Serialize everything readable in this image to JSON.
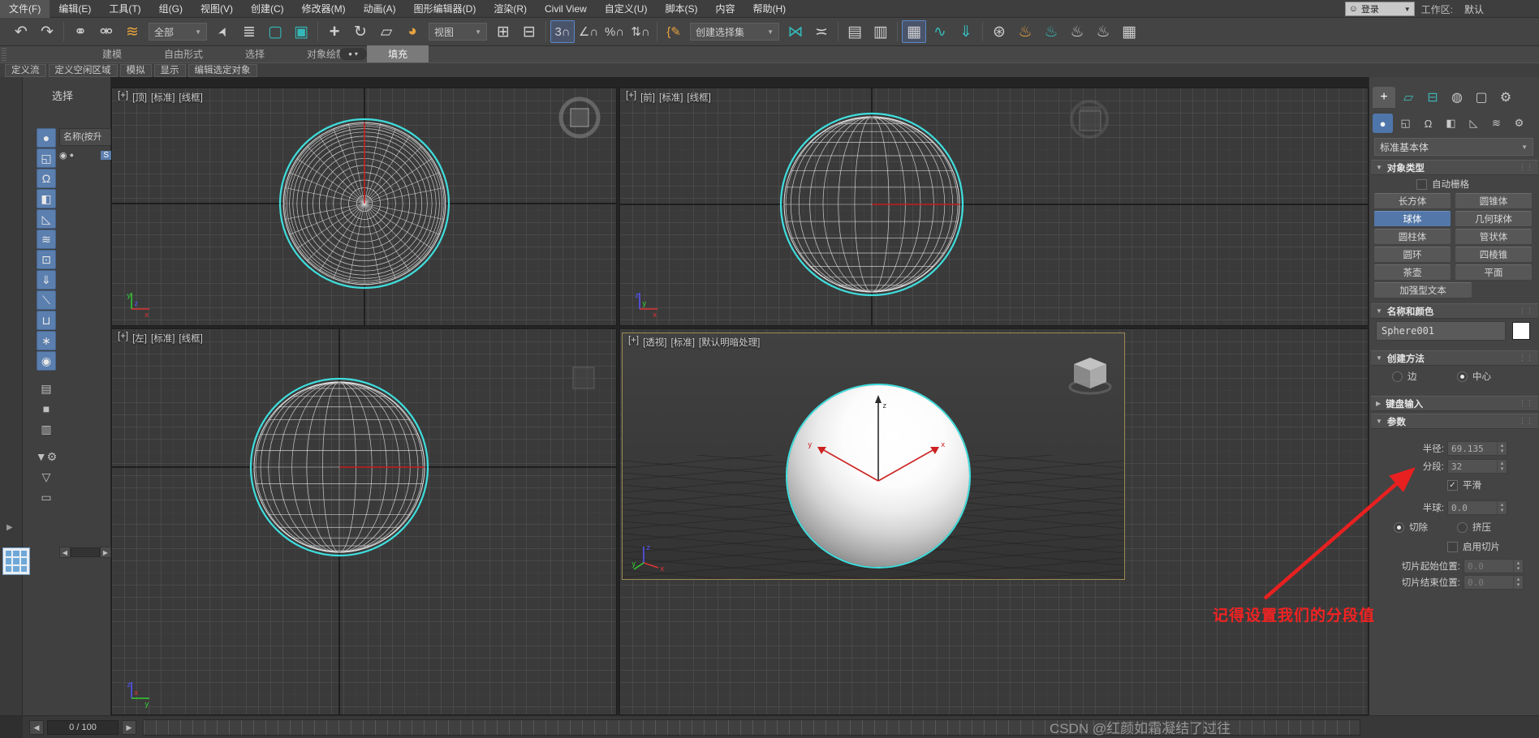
{
  "menubar": {
    "items": [
      "文件(F)",
      "编辑(E)",
      "工具(T)",
      "组(G)",
      "视图(V)",
      "创建(C)",
      "修改器(M)",
      "动画(A)",
      "图形编辑器(D)",
      "渲染(R)",
      "Civil View",
      "自定义(U)",
      "脚本(S)",
      "内容",
      "帮助(H)"
    ],
    "login_icon": "☺",
    "login": "登录",
    "workspace_label": "工作区:",
    "workspace_value": "默认"
  },
  "toolbar": {
    "filter_value": "全部",
    "coord_value": "视图",
    "sets_value": "创建选择集",
    "icons": {
      "undo": "↶",
      "redo": "↷",
      "link": "⚭",
      "unlink": "⚮",
      "bind": "≋",
      "select": "➤",
      "select_by_name": "≣",
      "region": "▢",
      "crossing": "▣",
      "move": "+",
      "rotate": "↻",
      "scale": "▱",
      "placement": "◕",
      "pivot": "⊞",
      "center": "⊟",
      "snap": "3∩",
      "angle_snap": "∠∩",
      "percent_snap": "%∩",
      "spinner_snap": "⇅∩",
      "sets_edit": "{✎",
      "mirror": "⋈",
      "align": "≍",
      "layers": "▤",
      "stack": "▥",
      "ribbon": "▦",
      "curve": "∿",
      "schematic": "⇓",
      "utilities": "⊛",
      "render_setup": "♨",
      "render_frame": "♨",
      "render": "♨",
      "render_cloud": "♨",
      "assets": "▦"
    }
  },
  "ribbon": {
    "tabs": [
      "建模",
      "自由形式",
      "选择",
      "对象绘制",
      "填充"
    ],
    "pill_dot": "●",
    "row2": [
      "定义流",
      "定义空闲区域",
      "模拟",
      "显示",
      "编辑选定对象"
    ]
  },
  "explorer": {
    "title": "选择",
    "header": "名称(按升",
    "row_eye": "◉",
    "row_dot": "●",
    "row_text": "S",
    "scroll_left": "◀",
    "scroll_right": "▶"
  },
  "leftstrip": {
    "expand": "▶"
  },
  "viewports": {
    "top": {
      "labels": [
        "[+]",
        "[顶]",
        "[标准]",
        "[线框]"
      ]
    },
    "front": {
      "labels": [
        "[+]",
        "[前]",
        "[标准]",
        "[线框]"
      ]
    },
    "left": {
      "labels": [
        "[+]",
        "[左]",
        "[标准]",
        "[线框]"
      ]
    },
    "persp": {
      "labels": [
        "[+]",
        "[透视]",
        "[标准]",
        "[默认明暗处理]"
      ]
    },
    "axis": {
      "x": "x",
      "y": "y",
      "z": "z"
    }
  },
  "annotation": {
    "text": "记得设置我们的分段值"
  },
  "panel": {
    "category": "标准基本体",
    "tabs": {
      "create": "+",
      "modify": "▱",
      "hierarchy": "⊟",
      "motion": "◍",
      "display": "▢",
      "utilities": "⚙"
    },
    "cats": {
      "geometry": "●",
      "shapes": "◱",
      "lights": "Ω",
      "cameras": "◧",
      "helpers": "◺",
      "spacewarps": "≋",
      "systems": "⚙"
    },
    "rollouts": {
      "object_type": "对象类型",
      "name_color": "名称和颜色",
      "creation": "创建方法",
      "keyboard": "键盘输入",
      "params": "参数"
    },
    "autogrid": "自动栅格",
    "buttons": [
      "长方体",
      "圆锥体",
      "球体",
      "几何球体",
      "圆柱体",
      "管状体",
      "圆环",
      "四棱锥",
      "茶壶",
      "平面",
      "加强型文本"
    ],
    "name_value": "Sphere001",
    "radio_edge": "边",
    "radio_center": "中心",
    "radius_label": "半径:",
    "radius_value": "69.135",
    "segments_label": "分段:",
    "segments_value": "32",
    "smooth": "平滑",
    "hemisphere_label": "半球:",
    "hemisphere_value": "0.0",
    "chop": "切除",
    "squash": "挤压",
    "slice_enable": "启用切片",
    "slice_from_label": "切片起始位置:",
    "slice_from_value": "0.0",
    "slice_to_label": "切片结束位置:",
    "slice_to_value": "0.0"
  },
  "statusbar": {
    "prev": "◀",
    "next": "▶",
    "frame": "0 / 100"
  },
  "watermark": "CSDN @红颜如霜凝结了过往"
}
